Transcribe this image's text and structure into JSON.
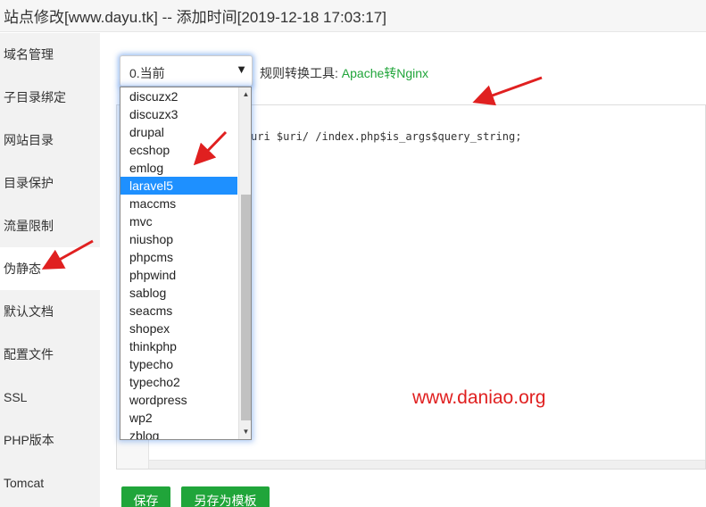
{
  "window": {
    "title": "站点修改[www.dayu.tk] -- 添加时间[2019-12-18 17:03:17]"
  },
  "sidebar": {
    "items": [
      {
        "label": "域名管理"
      },
      {
        "label": "子目录绑定"
      },
      {
        "label": "网站目录"
      },
      {
        "label": "目录保护"
      },
      {
        "label": "流量限制"
      },
      {
        "label": "伪静态",
        "active": true
      },
      {
        "label": "默认文档"
      },
      {
        "label": "配置文件"
      },
      {
        "label": "SSL"
      },
      {
        "label": "PHP版本"
      },
      {
        "label": "Tomcat"
      }
    ]
  },
  "rewrite": {
    "selected_value": "0.当前",
    "tool_label": "规则转换工具:",
    "tool_link": "Apache转Nginx",
    "options": [
      "discuzx2",
      "discuzx3",
      "drupal",
      "ecshop",
      "emlog",
      "laravel5",
      "maccms",
      "mvc",
      "niushop",
      "phpcms",
      "phpwind",
      "sablog",
      "seacms",
      "shopex",
      "thinkphp",
      "typecho",
      "typecho2",
      "wordpress",
      "wp2",
      "zblog"
    ],
    "highlighted_option": "laravel5"
  },
  "editor": {
    "code": "uri $uri/ /index.php$is_args$query_string;"
  },
  "watermark": "www.daniao.org",
  "buttons": {
    "save": "保存",
    "save_as_template": "另存为模板"
  },
  "colors": {
    "accent": "#20a53a",
    "selection": "#1e90ff",
    "annotation_arrow": "#e02020"
  },
  "icons": {
    "select_arrow": "triangle-down",
    "scroll_up": "triangle-up",
    "scroll_down": "triangle-down"
  }
}
